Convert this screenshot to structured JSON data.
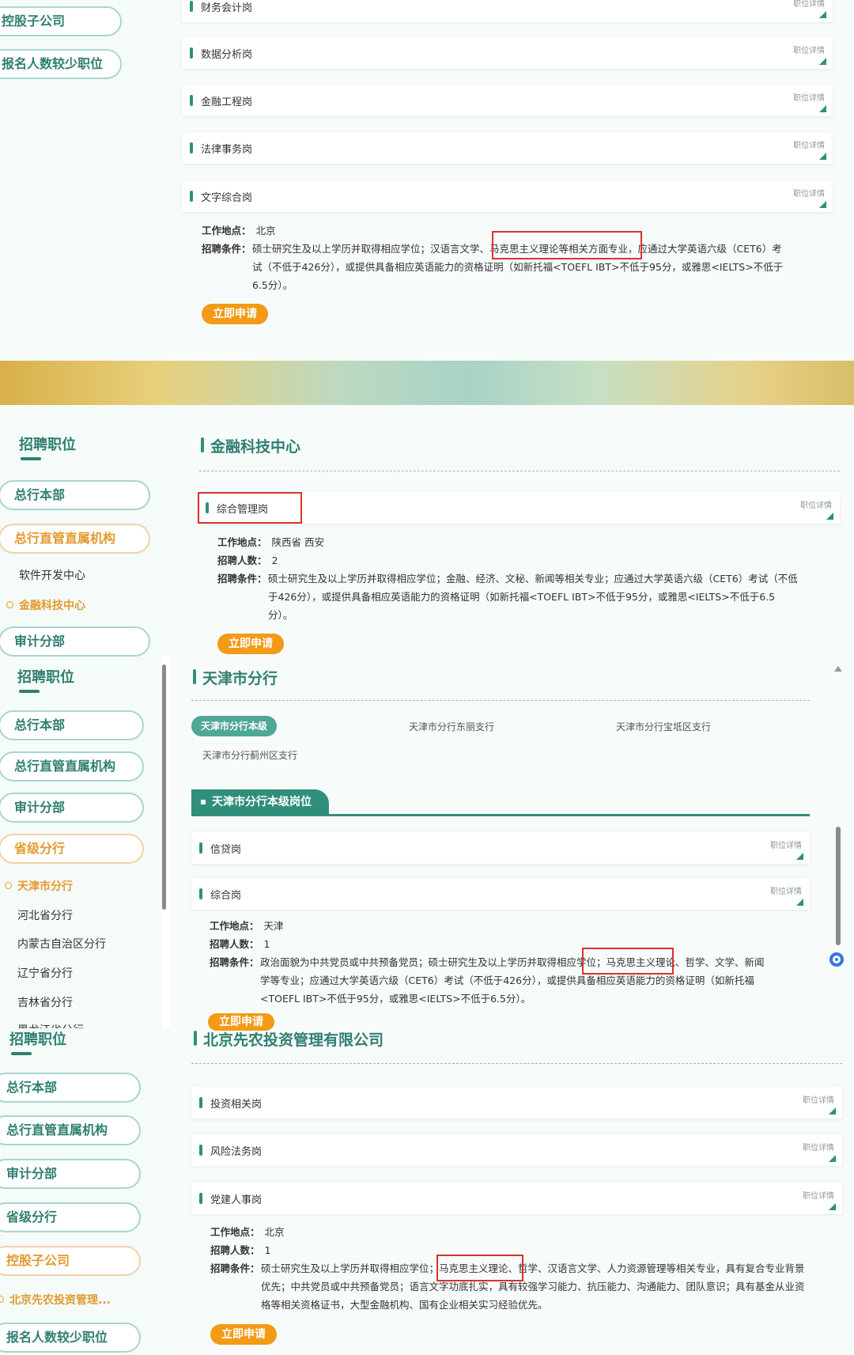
{
  "s1": {
    "sidebar": [
      "控股子公司",
      "报名人数较少职位"
    ],
    "jobs": [
      "财务会计岗",
      "数据分析岗",
      "金融工程岗",
      "法律事务岗",
      "文字综合岗"
    ],
    "detail_label": "职位详情",
    "info": {
      "loc_label": "工作地点：",
      "loc": "北京",
      "cond_label": "招聘条件：",
      "cond_a": "硕士研究生及以上学历并取得相应学位；汉语言文学、",
      "cond_hl": "马克思主义理论等相关方面专业",
      "cond_b": "，应通过大学英语六级（CET6）考试（不低于426分），或提供具备相应英语能力的资格证明（如新托福<TOEFL IBT>不低于95分，或雅思<IELTS>不低于6.5分）。"
    },
    "apply": "立即申请"
  },
  "s2": {
    "sidebar_title": "招聘职位",
    "pills": [
      "总行本部",
      "总行直管直属机构"
    ],
    "sub": [
      "软件开发中心",
      "金融科技中心"
    ],
    "pill3": "审计分部",
    "section": "金融科技中心",
    "job": "综合管理岗",
    "detail_label": "职位详情",
    "info": {
      "loc_label": "工作地点：",
      "loc": "陕西省 西安",
      "num_label": "招聘人数：",
      "num": "2",
      "cond_label": "招聘条件：",
      "cond": "硕士研究生及以上学历并取得相应学位；金融、经济、文秘、新闻等相关专业；应通过大学英语六级（CET6）考试（不低于426分），或提供具备相应英语能力的资格证明（如新托福<TOEFL IBT>不低于95分，或雅思<IELTS>不低于6.5分）。"
    },
    "apply": "立即申请"
  },
  "s3": {
    "sidebar_title": "招聘职位",
    "pills": [
      "总行本部",
      "总行直管直属机构",
      "审计分部",
      "省级分行"
    ],
    "sub": [
      "天津市分行",
      "河北省分行",
      "内蒙古自治区分行",
      "辽宁省分行",
      "吉林省分行",
      "黑龙江省分行"
    ],
    "section": "天津市分行",
    "tabs": [
      "天津市分行本级",
      "天津市分行东丽支行",
      "天津市分行宝坻区支行",
      "天津市分行蓟州区支行"
    ],
    "subtab": "天津市分行本级岗位",
    "jobs": [
      "信贷岗",
      "综合岗"
    ],
    "detail_label": "职位详情",
    "info": {
      "loc_label": "工作地点：",
      "loc": "天津",
      "num_label": "招聘人数：",
      "num": "1",
      "cond_label": "招聘条件：",
      "cond_a": "政治面貌为中共党员或中共预备党员；硕士研究生及以上学历并取得相应学位；",
      "cond_hl": "马克思主义理论、",
      "cond_b": "哲学、文学、新闻学等专业；应通过大学英语六级（CET6）考试（不低于426分），或提供具备相应英语能力的资格证明（如新托福<TOEFL IBT>不低于95分，或雅思<IELTS>不低于6.5分）。"
    },
    "apply": "立即申请"
  },
  "s4": {
    "sidebar_title": "招聘职位",
    "pills": [
      "总行本部",
      "总行直管直属机构",
      "审计分部",
      "省级分行",
      "控股子公司"
    ],
    "sub": "北京先农投资管理...",
    "pill_last": "报名人数较少职位",
    "section": "北京先农投资管理有限公司",
    "jobs": [
      "投资相关岗",
      "风险法务岗",
      "党建人事岗"
    ],
    "detail_label": "职位详情",
    "info": {
      "loc_label": "工作地点：",
      "loc": "北京",
      "num_label": "招聘人数：",
      "num": "1",
      "cond_label": "招聘条件：",
      "cond_a": "硕士研究生及以上学历并取得相应学位；",
      "cond_hl": "马克思主义理论、",
      "cond_b": "哲学、汉语言文学、人力资源管理等相关专业，具有复合专业背景优先；中共党员或中共预备党员；语言文字功底扎实，具有较强学习能力、抗压能力、沟通能力、团队意识；具有基金从业资格等相关资格证书，大型金融机构、国有企业相关实习经验优先。"
    },
    "apply": "立即申请"
  },
  "colors": {
    "accent": "#2f7f70",
    "orange": "#f39a16",
    "highlight": "#d9322e"
  }
}
